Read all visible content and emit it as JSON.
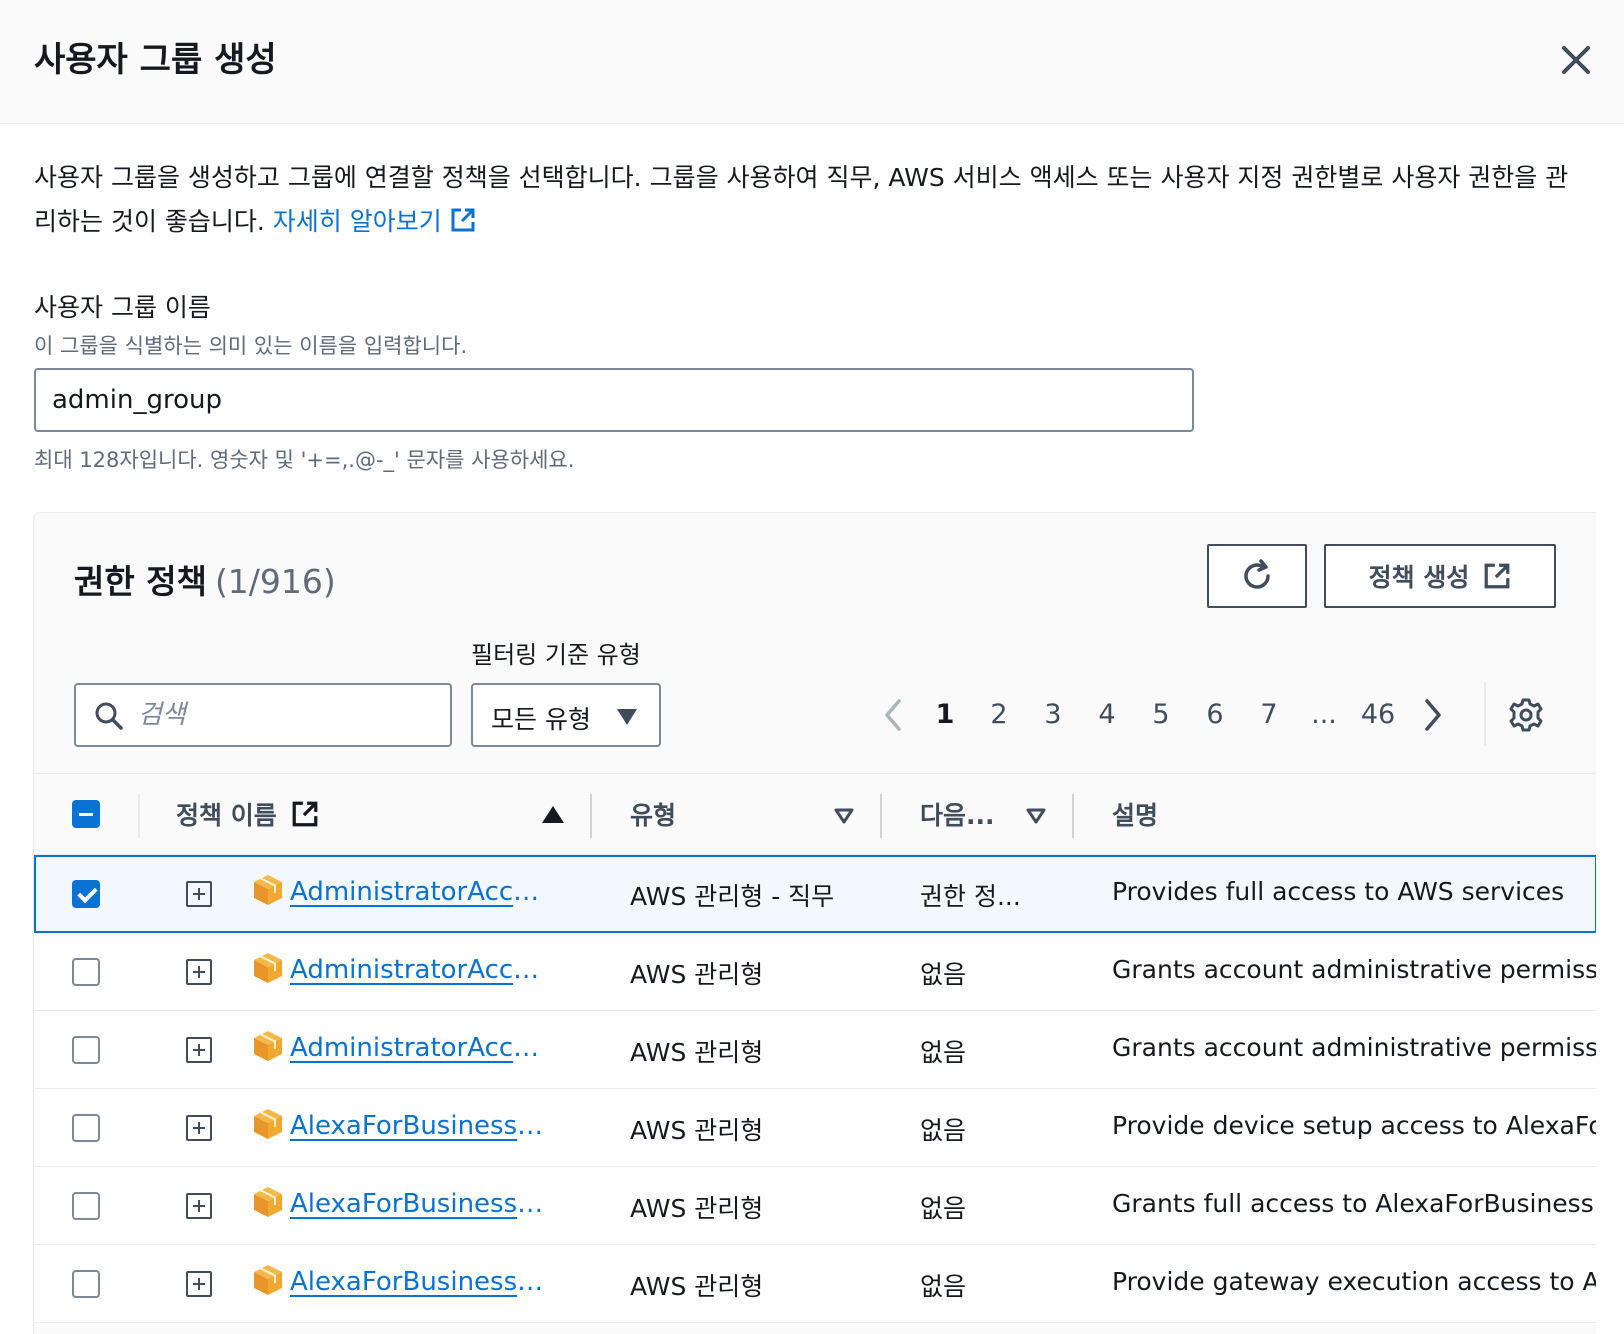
{
  "modal": {
    "title": "사용자 그룹 생성",
    "description": "사용자 그룹을 생성하고 그룹에 연결할 정책을 선택합니다. 그룹을 사용하여 직무, AWS 서비스 액세스 또는 사용자 지정 권한별로 사용자 권한을 관리하는 것이 좋습니다.",
    "learn_more": "자세히 알아보기"
  },
  "group_name": {
    "label": "사용자 그룹 이름",
    "hint": "이 그룹을 식별하는 의미 있는 이름을 입력합니다.",
    "value": "admin_group",
    "constraint": "최대 128자입니다. 영숫자 및 '+=,.@-_' 문자를 사용하세요."
  },
  "policies": {
    "title": "권한 정책",
    "count": "(1/916)",
    "create_button": "정책 생성",
    "filter_label": "필터링 기준 유형",
    "search_placeholder": "검색",
    "type_filter_value": "모든 유형",
    "pagination": {
      "pages": [
        "1",
        "2",
        "3",
        "4",
        "5",
        "6",
        "7",
        "...",
        "46"
      ],
      "current": "1"
    },
    "columns": {
      "name": "정책 이름",
      "type": "유형",
      "next": "다음...",
      "description": "설명"
    },
    "rows": [
      {
        "name": "AdministratorAccess",
        "type": "AWS 관리형 - 직무",
        "next": "권한 정...",
        "description": "Provides full access to AWS services",
        "selected": true
      },
      {
        "name": "AdministratorAccess-Amplify",
        "type": "AWS 관리형",
        "next": "없음",
        "description": "Grants account administrative permissions",
        "selected": false
      },
      {
        "name": "AdministratorAccess-AWSElasticBeanstalk",
        "type": "AWS 관리형",
        "next": "없음",
        "description": "Grants account administrative permissions",
        "selected": false
      },
      {
        "name": "AlexaForBusinessDeviceSetup",
        "type": "AWS 관리형",
        "next": "없음",
        "description": "Provide device setup access to AlexaForBusiness",
        "selected": false
      },
      {
        "name": "AlexaForBusinessFullAccess",
        "type": "AWS 관리형",
        "next": "없음",
        "description": "Grants full access to AlexaForBusiness",
        "selected": false
      },
      {
        "name": "AlexaForBusinessGatewayExecution",
        "type": "AWS 관리형",
        "next": "없음",
        "description": "Provide gateway execution access to AlexaForBusiness",
        "selected": false
      }
    ]
  },
  "colors": {
    "link": "#0972d3",
    "selected_border": "#0972d3",
    "cube": "#f0a830"
  },
  "icons": [
    "close-icon",
    "external-link-icon",
    "refresh-icon",
    "search-icon",
    "caret-down-icon",
    "chevron-left-icon",
    "chevron-right-icon",
    "gear-icon",
    "sort-ascending-icon",
    "sort-descending-icon",
    "expand-icon",
    "policy-cube-icon"
  ]
}
